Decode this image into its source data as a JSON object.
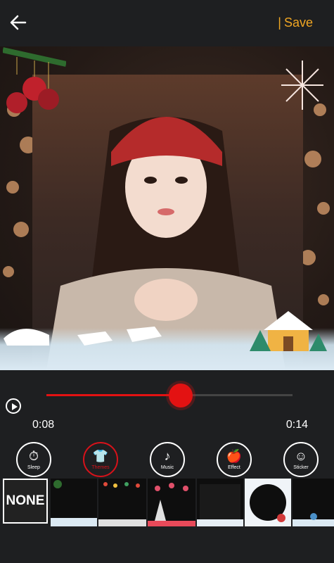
{
  "header": {
    "back_icon": "arrow-left-icon",
    "save_separator": "|",
    "save_label": "Save"
  },
  "player": {
    "current_time": "0:08",
    "total_time": "0:14",
    "progress": 0.546
  },
  "tools": [
    {
      "label": "Sleep",
      "icon": "stopwatch-icon"
    },
    {
      "label": "Themes",
      "icon": "shirt-icon"
    },
    {
      "label": "Music",
      "icon": "music-icon"
    },
    {
      "label": "Effect",
      "icon": "apple-icon"
    },
    {
      "label": "Sticker",
      "icon": "smiley-icon"
    }
  ],
  "themes": {
    "none_label": "NONE"
  },
  "colors": {
    "accent": "#e31212",
    "save": "#f0a623",
    "background": "#1e1f21"
  }
}
